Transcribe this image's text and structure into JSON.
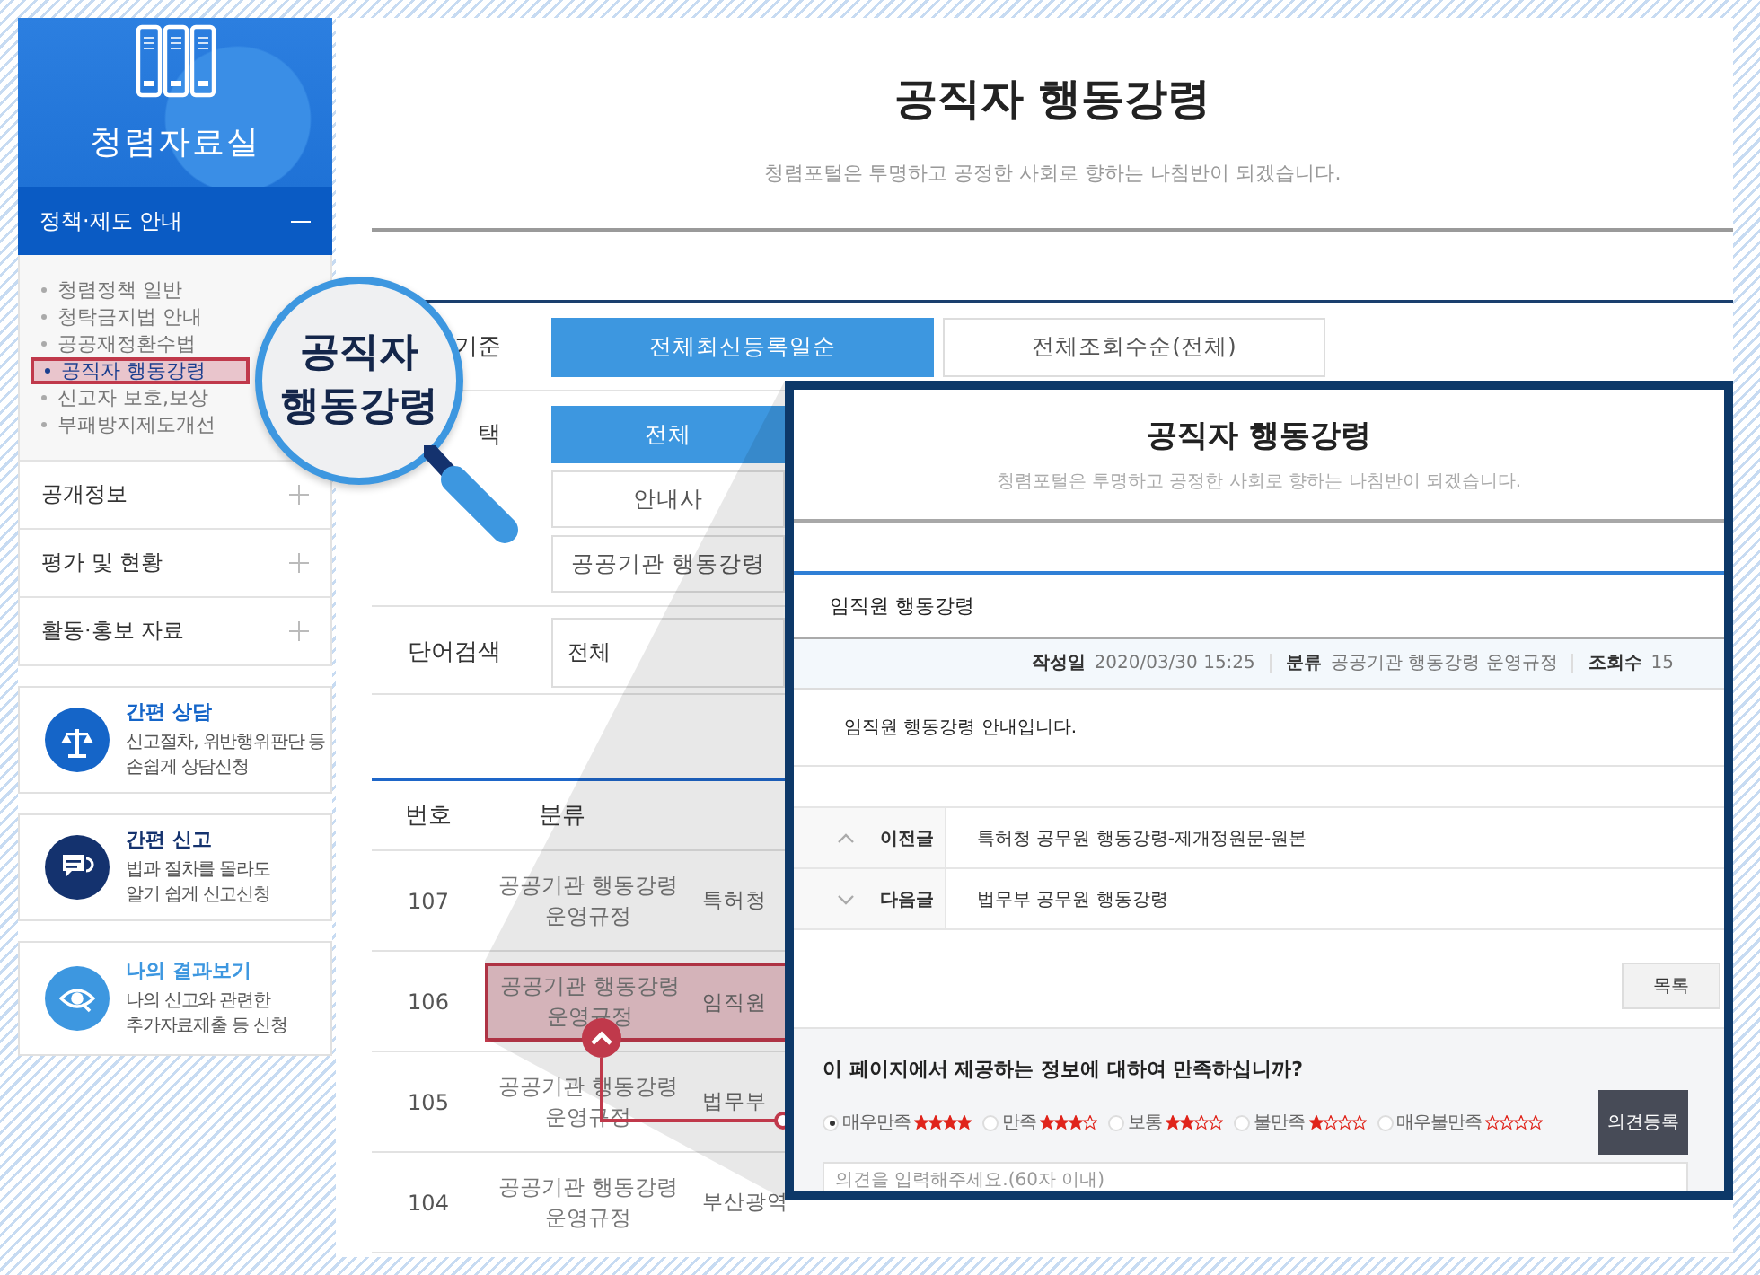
{
  "sidebar": {
    "title": "청렴자료실",
    "sections": [
      {
        "label": "정책·제도 안내",
        "expanded": true,
        "children": [
          {
            "label": "청렴정책 일반",
            "selected": false
          },
          {
            "label": "청탁금지법 안내",
            "selected": false
          },
          {
            "label": "공공재정환수법",
            "selected": false
          },
          {
            "label": "공직자 행동강령",
            "selected": true
          },
          {
            "label": "신고자 보호,보상",
            "selected": false
          },
          {
            "label": "부패방지제도개선",
            "selected": false
          }
        ]
      },
      {
        "label": "공개정보",
        "expanded": false
      },
      {
        "label": "평가 및 현황",
        "expanded": false
      },
      {
        "label": "활동·홍보 자료",
        "expanded": false
      }
    ],
    "shortcuts": [
      {
        "kind": "consult",
        "color": "#1565c8",
        "title": "간편 상담",
        "lines": [
          "신고절차, 위반행위판단 등",
          "손쉽게 상담신청"
        ]
      },
      {
        "kind": "report",
        "color": "#14326e",
        "title": "간편 신고",
        "lines": [
          "법과 절차를 몰라도",
          "알기 쉽게 신고신청"
        ]
      },
      {
        "kind": "result",
        "color": "#3d97e0",
        "title": "나의 결과보기",
        "lines": [
          "나의 신고와 관련한",
          "추가자료제출 등 신청"
        ]
      }
    ]
  },
  "page": {
    "title": "공직자 행동강령",
    "subtitle": "청렴포털은 투명하고 공정한 사회로 향하는 나침반이 되겠습니다."
  },
  "filters": [
    {
      "kind": "sort",
      "label": "기준",
      "options": [
        {
          "label": "전체최신등록일순",
          "selected": true
        },
        {
          "label": "전체조회수순(전체)",
          "selected": false
        }
      ]
    },
    {
      "kind": "category",
      "label": "택",
      "options": [
        {
          "label": "전체",
          "selected": true
        },
        {
          "label": "안내사",
          "selected": false
        },
        {
          "label": "공공기관 행동강령",
          "selected": false
        }
      ]
    }
  ],
  "search": {
    "label": "단어검색",
    "scope": "전체"
  },
  "table": {
    "columns": [
      "번호",
      "분류"
    ],
    "rows": [
      {
        "number": "107",
        "category": "공공기관 행동강령 운영규정",
        "title": "특허청",
        "highlighted": false
      },
      {
        "number": "106",
        "category": "공공기관 행동강령 운영규정",
        "title": "임직원",
        "highlighted": true
      },
      {
        "number": "105",
        "category": "공공기관 행동강령 운영규정",
        "title": "법무부",
        "highlighted": false
      },
      {
        "number": "104",
        "category": "공공기관 행동강령 운영규정",
        "title": "부산광역",
        "highlighted": false
      }
    ]
  },
  "callout": {
    "label": "공직자 행동강령"
  },
  "detail": {
    "title": "공직자 행동강령",
    "subtitle": "청렴포털은 투명하고 공정한 사회로 향하는 나침반이 되겠습니다.",
    "post_title": "임직원 행동강령",
    "meta": [
      {
        "label": "작성일",
        "value": "2020/03/30 15:25"
      },
      {
        "label": "분류",
        "value": "공공기관 행동강령 운영규정"
      },
      {
        "label": "조회수",
        "value": "15"
      }
    ],
    "body": "임직원 행동강령 안내입니다.",
    "neighbors": [
      {
        "kind": "prev",
        "label": "이전글",
        "title": "특허청 공무원 행동강령-제개정원문-원본"
      },
      {
        "kind": "next",
        "label": "다음글",
        "title": "법무부 공무원 행동강령"
      }
    ],
    "list_button": "목록",
    "survey": {
      "question": "이 페이지에서 제공하는 정보에 대하여 만족하십니까?",
      "options": [
        {
          "label": "매우만족",
          "stars": 4,
          "selected": true
        },
        {
          "label": "만족",
          "stars": 3,
          "selected": false
        },
        {
          "label": "보통",
          "stars": 2,
          "selected": false
        },
        {
          "label": "불만족",
          "stars": 1,
          "selected": false
        },
        {
          "label": "매우불만족",
          "stars": 0,
          "selected": false
        }
      ],
      "submit": "의견등록",
      "placeholder": "의견을 입력해주세요.(60자 이내)"
    }
  }
}
